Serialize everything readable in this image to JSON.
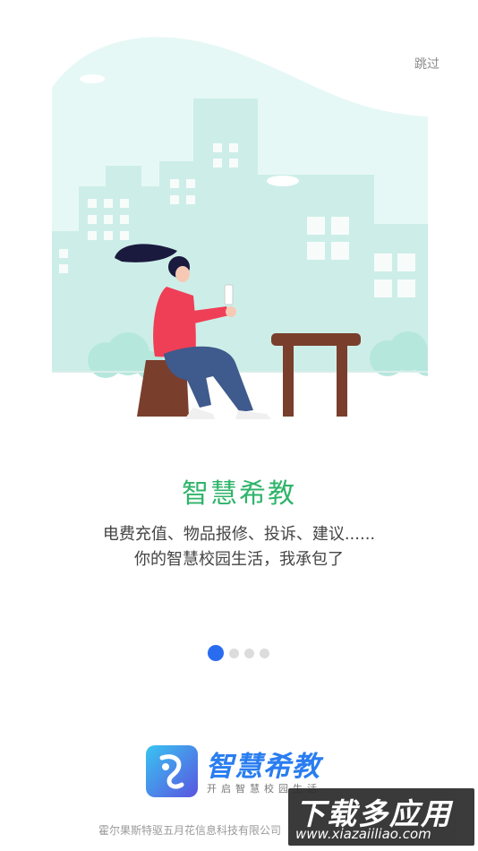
{
  "skip_label": "跳过",
  "title": "智慧希教",
  "description_line1": "电费充值、物品报修、投诉、建议......",
  "description_line2": "你的智慧校园生活，我承包了",
  "pagination": {
    "total": 4,
    "active_index": 1
  },
  "brand": {
    "name": "智慧希教",
    "slogan": "开启智慧校园生活"
  },
  "company": "霍尔果斯特驱五月花信息科技有限公司",
  "watermark": {
    "text": "下载多应用",
    "url": "www.xiazaiiliao.com"
  },
  "colors": {
    "title": "#2fb46a",
    "active_dot": "#2a6cf0",
    "brand": "#2a7df0",
    "bg_building": "#d6f3ee"
  }
}
